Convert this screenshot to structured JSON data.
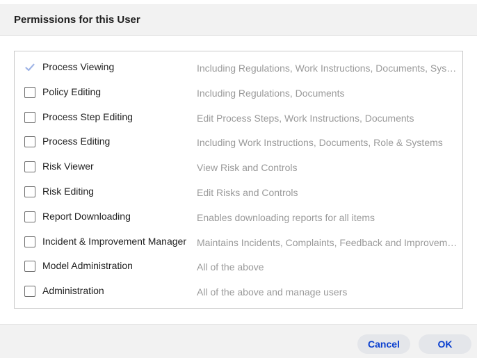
{
  "dialog": {
    "title": "Permissions for this User",
    "permissions": [
      {
        "name": "Process Viewing",
        "description": "Including Regulations, Work Instructions, Documents, Systems",
        "checked": true
      },
      {
        "name": "Policy Editing",
        "description": "Including Regulations, Documents",
        "checked": false
      },
      {
        "name": "Process Step Editing",
        "description": "Edit Process Steps, Work Instructions, Documents",
        "checked": false
      },
      {
        "name": "Process Editing",
        "description": "Including Work Instructions, Documents, Role & Systems",
        "checked": false
      },
      {
        "name": "Risk Viewer",
        "description": "View Risk and Controls",
        "checked": false
      },
      {
        "name": "Risk Editing",
        "description": "Edit Risks and Controls",
        "checked": false
      },
      {
        "name": "Report Downloading",
        "description": "Enables downloading reports for all items",
        "checked": false
      },
      {
        "name": "Incident & Improvement Manager",
        "description": "Maintains Incidents, Complaints, Feedback and Improvements",
        "checked": false
      },
      {
        "name": "Model Administration",
        "description": "All of the above",
        "checked": false
      },
      {
        "name": "Administration",
        "description": "All of the above and manage users",
        "checked": false
      }
    ],
    "buttons": {
      "cancel": "Cancel",
      "ok": "OK"
    }
  },
  "colors": {
    "accent": "#0a3fcf",
    "checked_checkbox": "#9fb4e6",
    "description_text": "#9a9a9a"
  }
}
